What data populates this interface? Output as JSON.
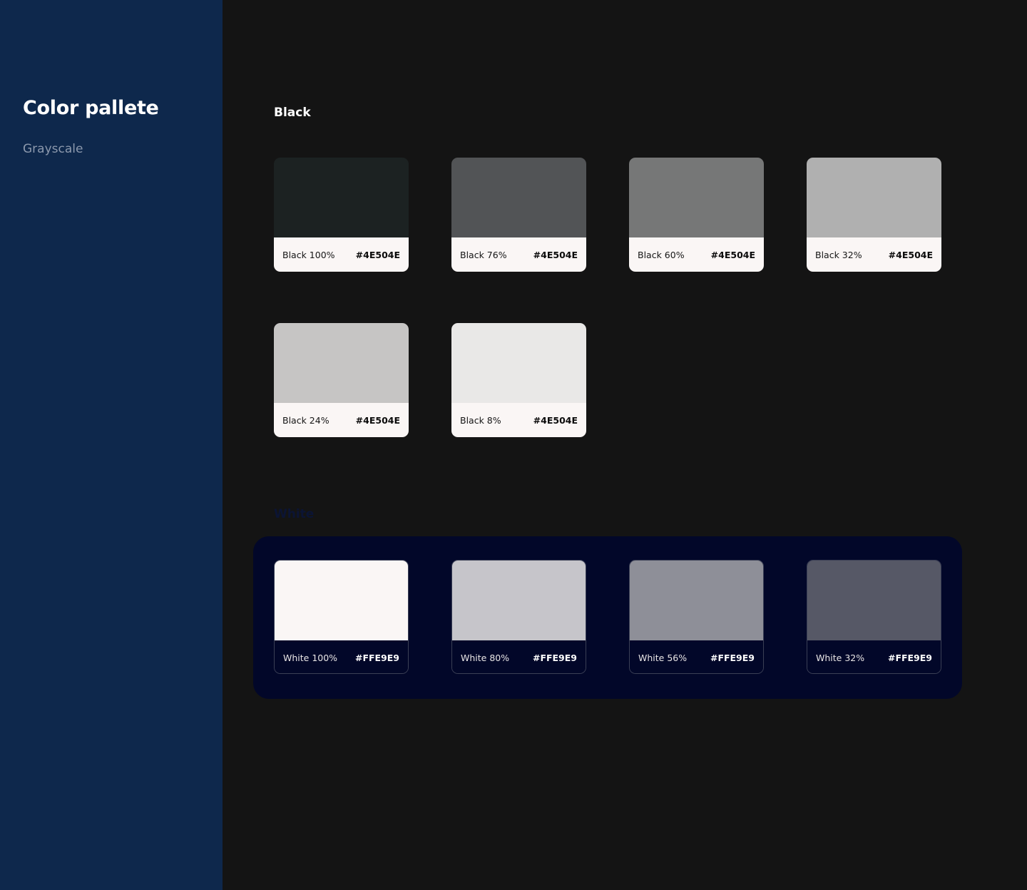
{
  "sidebar": {
    "title": "Color pallete",
    "subtitle": "Grayscale"
  },
  "black_section": {
    "title": "Black",
    "swatches": [
      {
        "label": "Black 100%",
        "hex": "#4E504E",
        "color": "#1C2222"
      },
      {
        "label": "Black 76%",
        "hex": "#4E504E",
        "color": "#525456"
      },
      {
        "label": "Black 60%",
        "hex": "#4E504E",
        "color": "#767777"
      },
      {
        "label": "Black 32%",
        "hex": "#4E504E",
        "color": "#B0B0B0"
      },
      {
        "label": "Black 24%",
        "hex": "#4E504E",
        "color": "#C6C5C4"
      },
      {
        "label": "Black 8%",
        "hex": "#4E504E",
        "color": "#E9E8E7"
      }
    ]
  },
  "white_section": {
    "title": "White",
    "swatches": [
      {
        "label": "White 100%",
        "hex": "#FFE9E9",
        "color": "#FAF6F5"
      },
      {
        "label": "White 80%",
        "hex": "#FFE9E9",
        "color": "#C6C5CA"
      },
      {
        "label": "White 56%",
        "hex": "#FFE9E9",
        "color": "#8E8F98"
      },
      {
        "label": "White 32%",
        "hex": "#FFE9E9",
        "color": "#565866"
      }
    ]
  }
}
